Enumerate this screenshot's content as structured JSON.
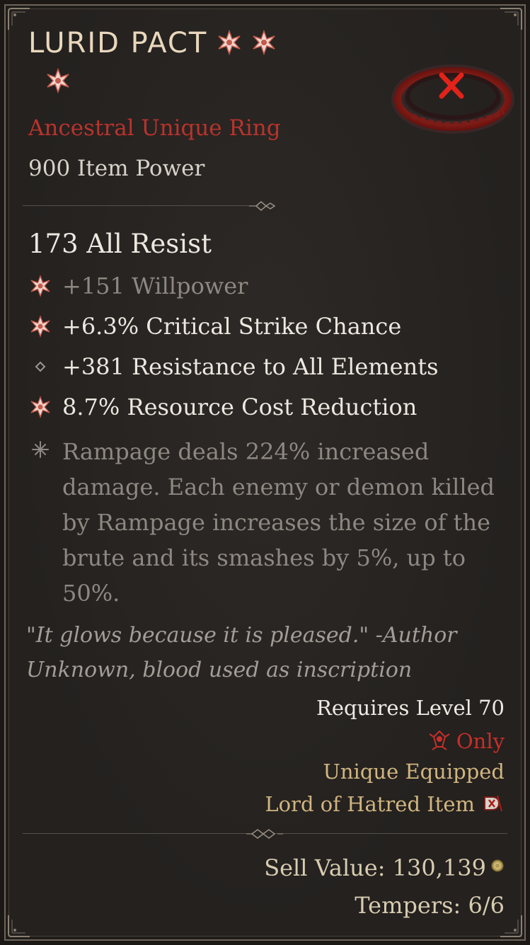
{
  "item": {
    "name": "LURID PACT",
    "type": "Ancestral Unique Ring",
    "item_power": "900 Item Power",
    "implicit": "173 All Resist",
    "affixes": [
      {
        "text": "+151 Willpower",
        "icon": "greater-affix-star-icon",
        "style": "dim"
      },
      {
        "text": "+6.3% Critical Strike Chance",
        "icon": "greater-affix-star-icon",
        "style": "bright"
      },
      {
        "text": "+381 Resistance to All Elements",
        "icon": "diamond-bullet-icon",
        "style": "bright"
      },
      {
        "text": "8.7% Resource Cost Reduction",
        "icon": "greater-affix-star-icon",
        "style": "bright"
      }
    ],
    "unique_power": "Rampage deals 224% increased damage. Each enemy or demon killed by Rampage increases the size of the brute and its smashes by 5%, up to 50%.",
    "flavor": "\"It glows because it is pleased.\" -Author Unknown, blood used as inscription",
    "requirements": {
      "level": "Requires Level 70",
      "class_only": "Only",
      "unique_equipped": "Unique Equipped",
      "expansion": "Lord of Hatred Item"
    },
    "sell_value": "Sell Value: 130,139",
    "tempers": "Tempers: 6/6"
  },
  "colors": {
    "title": "#e9d7bd",
    "unique_red": "#b9332c",
    "gold_text": "#d0b57f",
    "dim_text": "#8d8881",
    "bright_text": "#ece8e0"
  },
  "icons": {
    "title_stars": [
      "greater-affix-star-icon",
      "greater-affix-star-icon",
      "greater-affix-star-icon"
    ],
    "ring": "lurid-pact-ring-icon",
    "class": "spiritborn-class-icon",
    "expansion": "lord-of-hatred-expansion-icon",
    "gold": "gold-coin-icon",
    "unique_power": "unique-power-star-icon"
  }
}
